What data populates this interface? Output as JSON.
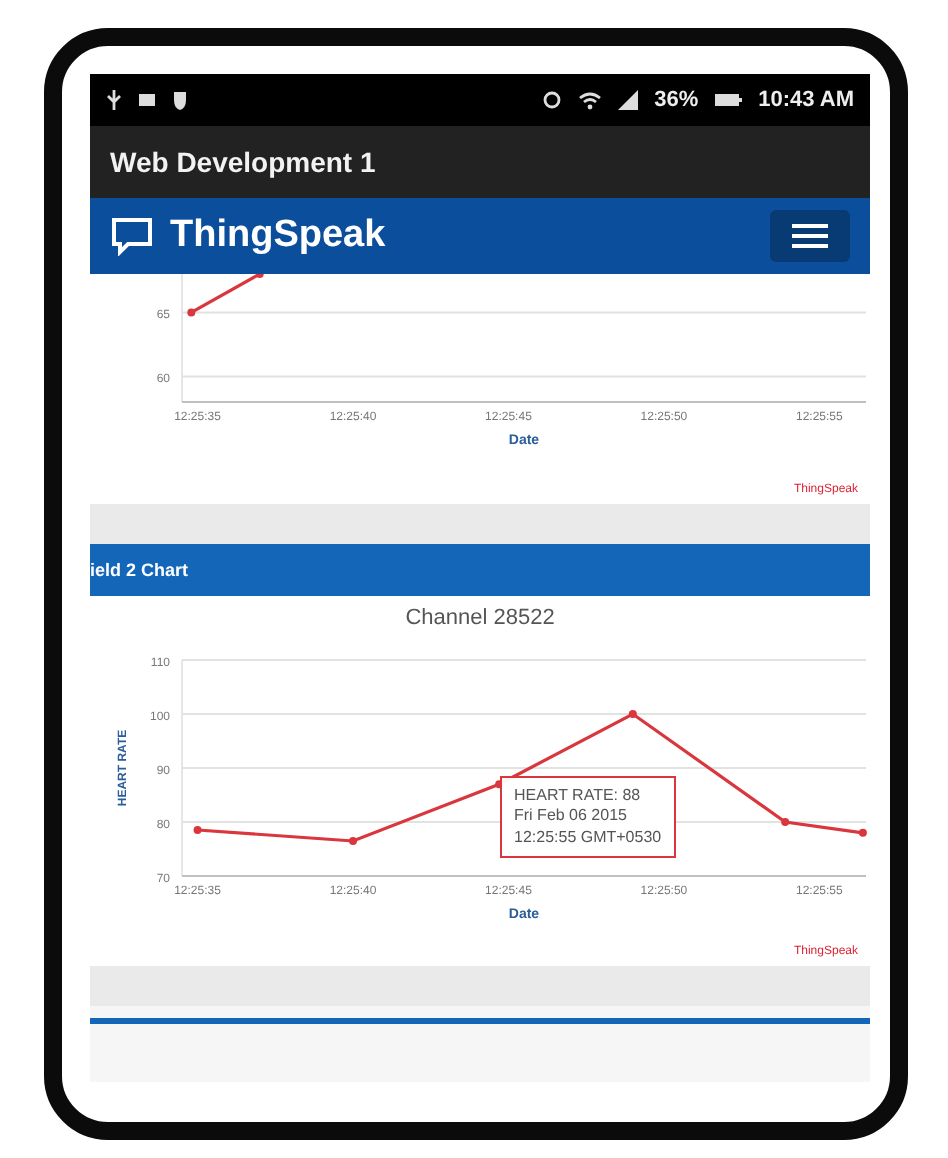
{
  "status_bar": {
    "battery": "36%",
    "time": "10:43 AM"
  },
  "app_bar": {
    "title": "Web Development 1"
  },
  "brand_bar": {
    "title": "ThingSpeak"
  },
  "charts": [
    {
      "chart_data": {
        "type": "line",
        "xlabel": "Date",
        "x": [
          44734.8,
          44737
        ],
        "xlim": [
          44734.5,
          44756.5
        ],
        "ylim": [
          58,
          68
        ],
        "yticks": [
          60,
          65
        ],
        "xticks": [
          {
            "value": 44735,
            "label": "12:25:35"
          },
          {
            "value": 44740,
            "label": "12:25:40"
          },
          {
            "value": 44745,
            "label": "12:25:45"
          },
          {
            "value": 44750,
            "label": "12:25:50"
          },
          {
            "value": 44755,
            "label": "12:25:55"
          }
        ],
        "grid": true,
        "series": [
          {
            "color": "#d9363e",
            "marker": true,
            "values": [
              65,
              68
            ]
          }
        ]
      },
      "credit": "ThingSpeak"
    },
    {
      "header": "ield 2 Chart",
      "chart_data": {
        "type": "line",
        "title": "Channel 28522",
        "xlabel": "Date",
        "ylabel": "HEART RATE",
        "x": [
          44735,
          44740,
          44744.7,
          44749,
          44753.9,
          44756.4
        ],
        "xlim": [
          44734.5,
          44756.5
        ],
        "ylim": [
          70,
          110
        ],
        "yticks": [
          70,
          80,
          90,
          100,
          110
        ],
        "xticks": [
          {
            "value": 44735,
            "label": "12:25:35"
          },
          {
            "value": 44740,
            "label": "12:25:40"
          },
          {
            "value": 44745,
            "label": "12:25:45"
          },
          {
            "value": 44750,
            "label": "12:25:50"
          },
          {
            "value": 44755,
            "label": "12:25:55"
          }
        ],
        "grid": true,
        "series": [
          {
            "color": "#d9363e",
            "marker": true,
            "values": [
              78.5,
              76.5,
              87,
              100,
              80,
              78
            ]
          }
        ]
      },
      "tooltip": [
        "HEART RATE: 88",
        "Fri Feb 06 2015",
        "12:25:55 GMT+0530"
      ],
      "credit": "ThingSpeak"
    }
  ]
}
